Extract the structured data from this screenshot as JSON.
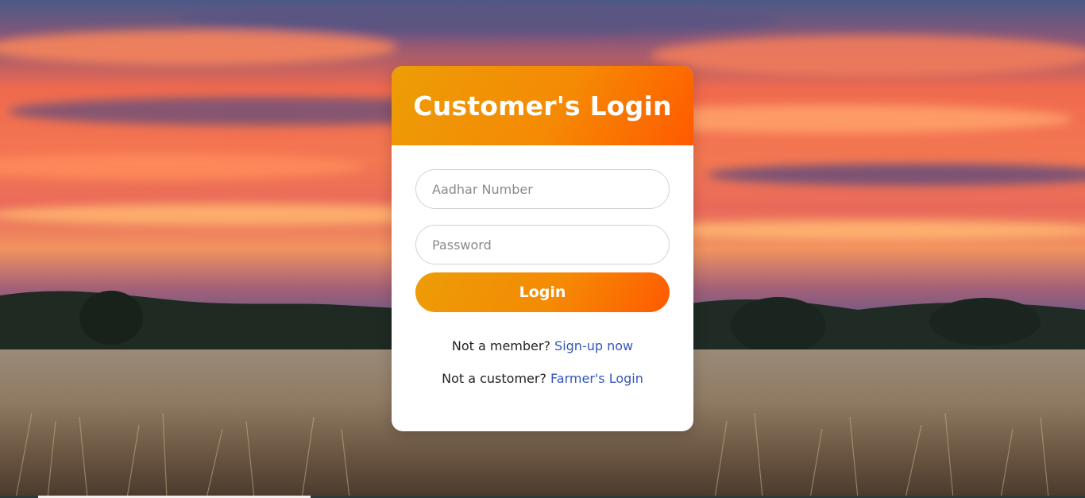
{
  "card": {
    "title": "Customer's Login"
  },
  "form": {
    "aadhar_placeholder": "Aadhar Number",
    "password_placeholder": "Password",
    "login_label": "Login"
  },
  "links": {
    "member_text": "Not a member?",
    "member_link": "Sign-up now",
    "customer_text": "Not a customer?",
    "customer_link": "Farmer's Login"
  },
  "colors": {
    "accent_start": "#ec9d07",
    "accent_end": "#ff5a00",
    "link": "#3557b8"
  }
}
